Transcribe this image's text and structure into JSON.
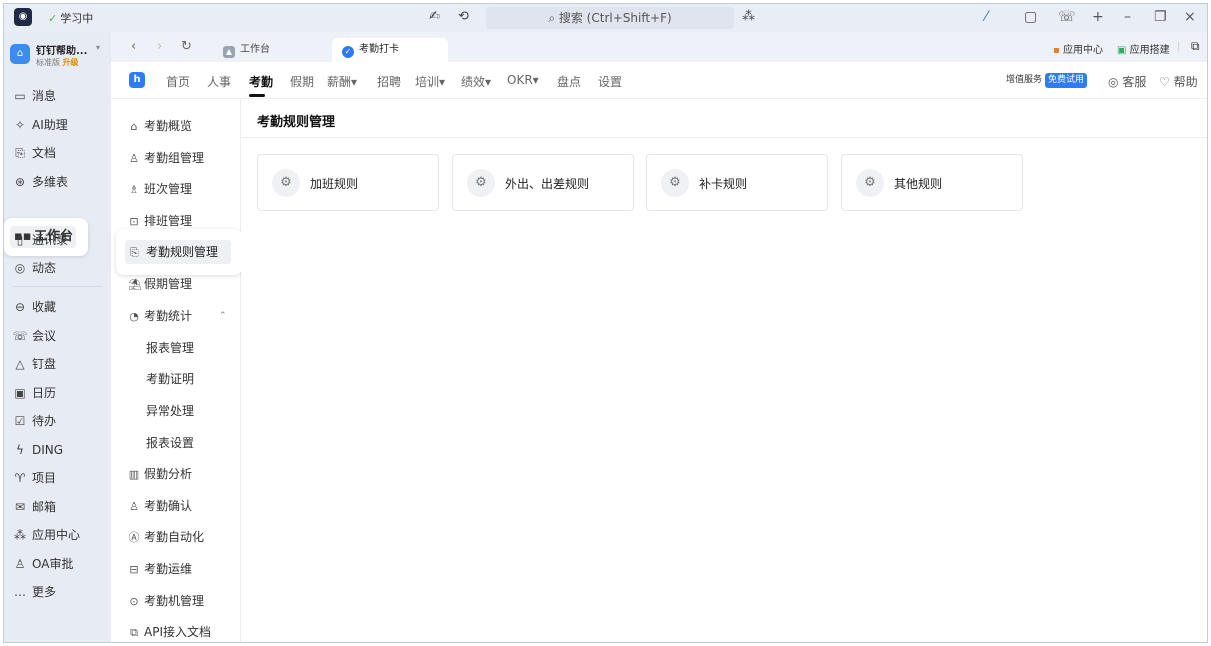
{
  "titlebar": {
    "status": "学习中",
    "search_placeholder": "搜索 (Ctrl+Shift+F)"
  },
  "org": {
    "name": "钉钉帮助...",
    "edition": "标准版",
    "upgrade": "升级"
  },
  "leftnav": {
    "items": [
      {
        "label": "消息",
        "icon": "message-icon"
      },
      {
        "label": "AI助理",
        "icon": "ai-icon"
      },
      {
        "label": "文档",
        "icon": "doc-icon"
      },
      {
        "label": "多维表",
        "icon": "table-icon"
      },
      {
        "label": "工作台",
        "icon": "grid-icon"
      },
      {
        "label": "通讯录",
        "icon": "contacts-icon"
      },
      {
        "label": "动态",
        "icon": "eye-icon"
      },
      {
        "label": "收藏",
        "icon": "bookmark-icon"
      },
      {
        "label": "会议",
        "icon": "phone-icon"
      },
      {
        "label": "钉盘",
        "icon": "cloud-icon"
      },
      {
        "label": "日历",
        "icon": "calendar-icon"
      },
      {
        "label": "待办",
        "icon": "todo-icon"
      },
      {
        "label": "DING",
        "icon": "ding-icon"
      },
      {
        "label": "项目",
        "icon": "project-icon"
      },
      {
        "label": "邮箱",
        "icon": "mail-icon"
      },
      {
        "label": "应用中心",
        "icon": "apps-icon"
      },
      {
        "label": "OA审批",
        "icon": "approval-icon"
      },
      {
        "label": "更多",
        "icon": "more-icon"
      }
    ]
  },
  "tabs": {
    "tab1": "工作台",
    "tab2": "考勤打卡",
    "app_center": "应用中心",
    "app_builder": "应用搭建"
  },
  "menu": {
    "items": [
      "首页",
      "人事",
      "考勤",
      "假期",
      "薪酬▾",
      "招聘",
      "培训▾",
      "绩效▾",
      "OKR▾",
      "盘点",
      "设置"
    ],
    "value_added": "增值服务",
    "free_trial": "免费试用",
    "service": "客服",
    "help": "帮助"
  },
  "subnav": {
    "items": [
      {
        "label": "考勤概览",
        "icon": "home-icon"
      },
      {
        "label": "考勤组管理",
        "icon": "group-icon"
      },
      {
        "label": "班次管理",
        "icon": "shift-icon"
      },
      {
        "label": "排班管理",
        "icon": "schedule-icon"
      },
      {
        "label": "考勤规则管理",
        "icon": "rule-icon"
      },
      {
        "label": "假期管理",
        "icon": "holiday-icon"
      },
      {
        "label": "考勤统计",
        "icon": "stats-icon"
      }
    ],
    "children": [
      "报表管理",
      "考勤证明",
      "异常处理",
      "报表设置"
    ],
    "items2": [
      {
        "label": "假勤分析",
        "icon": "chart-icon"
      },
      {
        "label": "考勤确认",
        "icon": "confirm-icon"
      },
      {
        "label": "考勤自动化",
        "icon": "auto-icon"
      },
      {
        "label": "考勤运维",
        "icon": "ops-icon"
      },
      {
        "label": "考勤机管理",
        "icon": "device-icon"
      },
      {
        "label": "API接入文档",
        "icon": "api-icon"
      }
    ]
  },
  "main": {
    "title": "考勤规则管理",
    "cards": [
      "加班规则",
      "外出、出差规则",
      "补卡规则",
      "其他规则"
    ]
  }
}
